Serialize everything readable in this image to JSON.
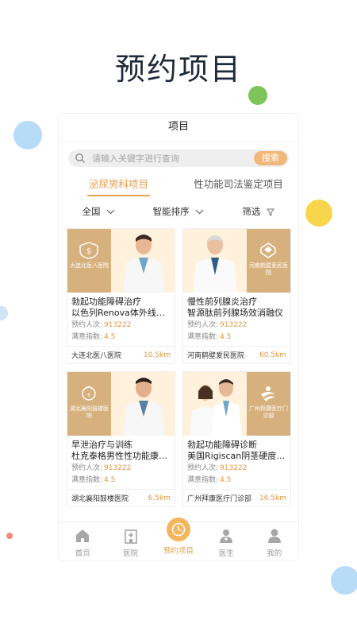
{
  "hero": {
    "title": "预约项目"
  },
  "nav": {
    "title": "项目"
  },
  "search": {
    "placeholder": "请输入关键字进行查询",
    "button": "搜索"
  },
  "categories": [
    {
      "label": "泌尿男科项目",
      "active": true
    },
    {
      "label": "性功能司法鉴定项目",
      "active": false
    }
  ],
  "filters": {
    "region": "全国",
    "sort": "智能排序",
    "filter": "筛选"
  },
  "stats_labels": {
    "bookings": "预约人次:",
    "satisfaction": "满意指数:"
  },
  "cards": [
    {
      "title1": "勃起功能障碍治疗",
      "title2": "以色列Renova体外线…",
      "bookings": "913222",
      "satisfaction": "4.5",
      "hospital": "大连北医八医院",
      "distance": "10.5km",
      "logo_text": "大连北医八医院",
      "logo_side": "left"
    },
    {
      "title1": "慢性前列腺炎治疗",
      "title2": "智源肽前列腺场效消融仪",
      "bookings": "913222",
      "satisfaction": "4.5",
      "hospital": "河南鹤壁爱民医院",
      "distance": "60.5km",
      "logo_text": "河南鹤壁爱民医院",
      "logo_side": "right"
    },
    {
      "title1": "早泄治疗与训练",
      "title2": "杜克泰格男性性功能康…",
      "bookings": "913222",
      "satisfaction": "4.5",
      "hospital": "湖北襄阳鼓楼医院",
      "distance": "6.5km",
      "logo_text": "湖北襄阳鼓楼医院",
      "logo_side": "left"
    },
    {
      "title1": "勃起功能障碍诊断",
      "title2": "美国Rigiscan阴茎硬度…",
      "bookings": "913222",
      "satisfaction": "4.5",
      "hospital": "广州拜康医疗门诊部",
      "distance": "16.5km",
      "logo_text": "广州拜康医疗门诊部",
      "logo_side": "right"
    }
  ],
  "tabs": [
    {
      "label": "首页",
      "icon": "home-icon"
    },
    {
      "label": "医院",
      "icon": "hospital-icon"
    },
    {
      "label": "预约项目",
      "icon": "clock-icon",
      "active": true
    },
    {
      "label": "医生",
      "icon": "doctor-icon"
    },
    {
      "label": "我的",
      "icon": "person-icon"
    }
  ],
  "colors": {
    "accent": "#e8a154",
    "panel": "#d6b07d",
    "card_bg": "#fff1dc"
  }
}
